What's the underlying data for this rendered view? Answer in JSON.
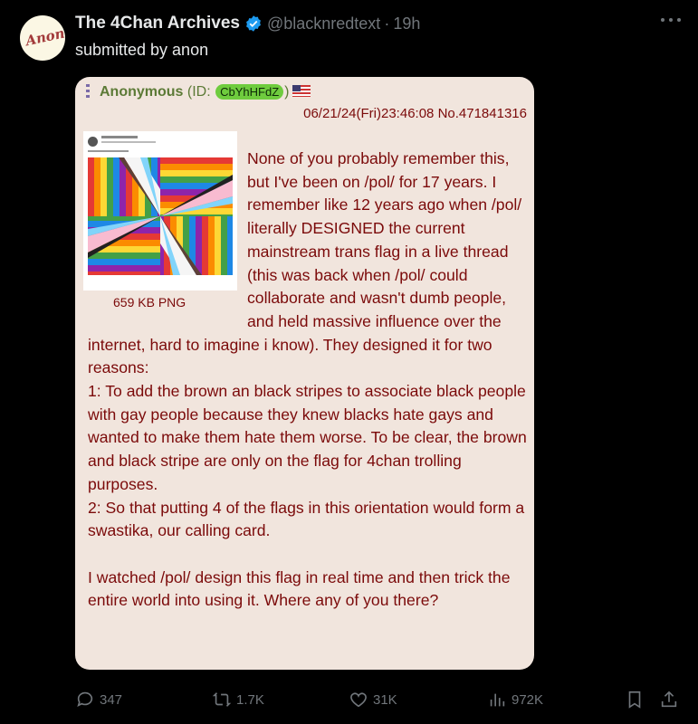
{
  "account": {
    "name": "The 4Chan Archives",
    "handle": "@blacknredtext",
    "separator": "·",
    "time": "19h",
    "avatar_text": "Anony",
    "verified_icon": "verified-badge-icon"
  },
  "post_text": "submitted by anon",
  "card": {
    "poster": "Anonymous",
    "id_prefix": "(ID:",
    "id": "CbYhHFdZ",
    "id_suffix": ")",
    "flag_icon": "us-flag-icon",
    "datetime": "06/21/24(Fri)23:46:08",
    "post_number": "No.471841316",
    "file_info": "659 KB PNG",
    "paragraphs": [
      "None of you probably remember this, but I've been on /pol/ for 17 years. I remember like 12 years ago when /pol/ literally DESIGNED the current mainstream trans flag in a live thread (this was back when /pol/ could collaborate and wasn't dumb people, and held massive influence over the internet, hard to imagine i know). They designed it for two reasons:",
      "1: To add the brown an black stripes to associate black people with gay people because they knew blacks hate gays and wanted to make them hate them worse. To be clear, the brown and black stripe are only on the flag for 4chan trolling purposes.",
      "2: So that putting 4 of the flags in this orientation would form a swastika, our calling card.",
      "I watched /pol/ design this flag in real time and then trick the entire world into using it. Where any of you there?"
    ]
  },
  "actions": {
    "replies": "347",
    "reposts": "1.7K",
    "likes": "31K",
    "views": "972K"
  },
  "colors": {
    "background": "#000000",
    "card": "#f1e5dd",
    "post_text": "#7b0a0a",
    "name_green": "#5c7a36",
    "id_pill": "#6fcc3e",
    "muted": "#71767b",
    "verified": "#1d9bf0"
  }
}
